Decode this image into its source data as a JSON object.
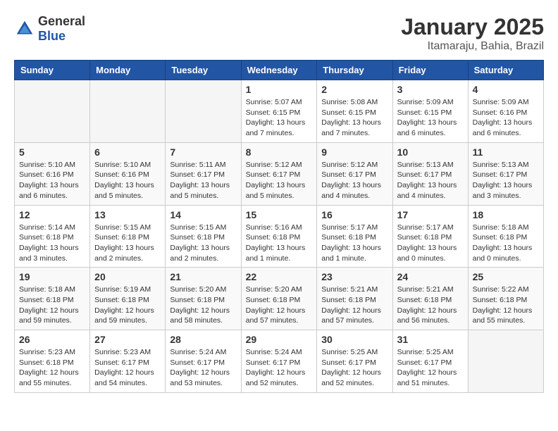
{
  "header": {
    "logo_general": "General",
    "logo_blue": "Blue",
    "month": "January 2025",
    "location": "Itamaraju, Bahia, Brazil"
  },
  "weekdays": [
    "Sunday",
    "Monday",
    "Tuesday",
    "Wednesday",
    "Thursday",
    "Friday",
    "Saturday"
  ],
  "weeks": [
    [
      {
        "day": "",
        "info": ""
      },
      {
        "day": "",
        "info": ""
      },
      {
        "day": "",
        "info": ""
      },
      {
        "day": "1",
        "info": "Sunrise: 5:07 AM\nSunset: 6:15 PM\nDaylight: 13 hours and 7 minutes."
      },
      {
        "day": "2",
        "info": "Sunrise: 5:08 AM\nSunset: 6:15 PM\nDaylight: 13 hours and 7 minutes."
      },
      {
        "day": "3",
        "info": "Sunrise: 5:09 AM\nSunset: 6:15 PM\nDaylight: 13 hours and 6 minutes."
      },
      {
        "day": "4",
        "info": "Sunrise: 5:09 AM\nSunset: 6:16 PM\nDaylight: 13 hours and 6 minutes."
      }
    ],
    [
      {
        "day": "5",
        "info": "Sunrise: 5:10 AM\nSunset: 6:16 PM\nDaylight: 13 hours and 6 minutes."
      },
      {
        "day": "6",
        "info": "Sunrise: 5:10 AM\nSunset: 6:16 PM\nDaylight: 13 hours and 5 minutes."
      },
      {
        "day": "7",
        "info": "Sunrise: 5:11 AM\nSunset: 6:17 PM\nDaylight: 13 hours and 5 minutes."
      },
      {
        "day": "8",
        "info": "Sunrise: 5:12 AM\nSunset: 6:17 PM\nDaylight: 13 hours and 5 minutes."
      },
      {
        "day": "9",
        "info": "Sunrise: 5:12 AM\nSunset: 6:17 PM\nDaylight: 13 hours and 4 minutes."
      },
      {
        "day": "10",
        "info": "Sunrise: 5:13 AM\nSunset: 6:17 PM\nDaylight: 13 hours and 4 minutes."
      },
      {
        "day": "11",
        "info": "Sunrise: 5:13 AM\nSunset: 6:17 PM\nDaylight: 13 hours and 3 minutes."
      }
    ],
    [
      {
        "day": "12",
        "info": "Sunrise: 5:14 AM\nSunset: 6:18 PM\nDaylight: 13 hours and 3 minutes."
      },
      {
        "day": "13",
        "info": "Sunrise: 5:15 AM\nSunset: 6:18 PM\nDaylight: 13 hours and 2 minutes."
      },
      {
        "day": "14",
        "info": "Sunrise: 5:15 AM\nSunset: 6:18 PM\nDaylight: 13 hours and 2 minutes."
      },
      {
        "day": "15",
        "info": "Sunrise: 5:16 AM\nSunset: 6:18 PM\nDaylight: 13 hours and 1 minute."
      },
      {
        "day": "16",
        "info": "Sunrise: 5:17 AM\nSunset: 6:18 PM\nDaylight: 13 hours and 1 minute."
      },
      {
        "day": "17",
        "info": "Sunrise: 5:17 AM\nSunset: 6:18 PM\nDaylight: 13 hours and 0 minutes."
      },
      {
        "day": "18",
        "info": "Sunrise: 5:18 AM\nSunset: 6:18 PM\nDaylight: 13 hours and 0 minutes."
      }
    ],
    [
      {
        "day": "19",
        "info": "Sunrise: 5:18 AM\nSunset: 6:18 PM\nDaylight: 12 hours and 59 minutes."
      },
      {
        "day": "20",
        "info": "Sunrise: 5:19 AM\nSunset: 6:18 PM\nDaylight: 12 hours and 59 minutes."
      },
      {
        "day": "21",
        "info": "Sunrise: 5:20 AM\nSunset: 6:18 PM\nDaylight: 12 hours and 58 minutes."
      },
      {
        "day": "22",
        "info": "Sunrise: 5:20 AM\nSunset: 6:18 PM\nDaylight: 12 hours and 57 minutes."
      },
      {
        "day": "23",
        "info": "Sunrise: 5:21 AM\nSunset: 6:18 PM\nDaylight: 12 hours and 57 minutes."
      },
      {
        "day": "24",
        "info": "Sunrise: 5:21 AM\nSunset: 6:18 PM\nDaylight: 12 hours and 56 minutes."
      },
      {
        "day": "25",
        "info": "Sunrise: 5:22 AM\nSunset: 6:18 PM\nDaylight: 12 hours and 55 minutes."
      }
    ],
    [
      {
        "day": "26",
        "info": "Sunrise: 5:23 AM\nSunset: 6:18 PM\nDaylight: 12 hours and 55 minutes."
      },
      {
        "day": "27",
        "info": "Sunrise: 5:23 AM\nSunset: 6:17 PM\nDaylight: 12 hours and 54 minutes."
      },
      {
        "day": "28",
        "info": "Sunrise: 5:24 AM\nSunset: 6:17 PM\nDaylight: 12 hours and 53 minutes."
      },
      {
        "day": "29",
        "info": "Sunrise: 5:24 AM\nSunset: 6:17 PM\nDaylight: 12 hours and 52 minutes."
      },
      {
        "day": "30",
        "info": "Sunrise: 5:25 AM\nSunset: 6:17 PM\nDaylight: 12 hours and 52 minutes."
      },
      {
        "day": "31",
        "info": "Sunrise: 5:25 AM\nSunset: 6:17 PM\nDaylight: 12 hours and 51 minutes."
      },
      {
        "day": "",
        "info": ""
      }
    ]
  ]
}
